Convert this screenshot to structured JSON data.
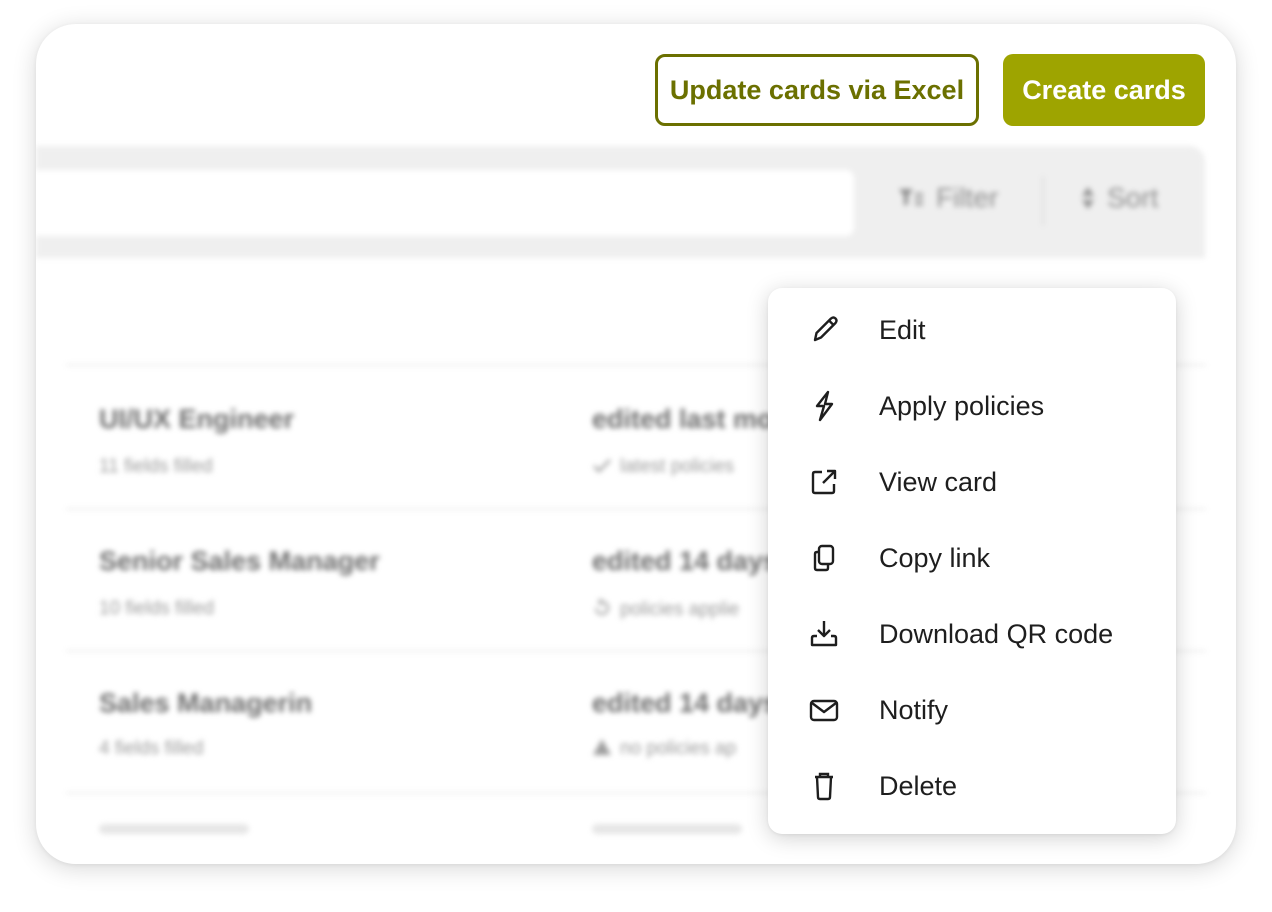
{
  "actions": {
    "update_excel_label": "Update cards via Excel",
    "create_cards_label": "Create cards",
    "accent_color": "#9ea400"
  },
  "toolbar": {
    "search_value": "",
    "filter_label": "Filter",
    "sort_label": "Sort"
  },
  "cards": [
    {
      "title": "UI/UX Engineer",
      "fields": "11 fields filled",
      "edited": "edited last mo",
      "policy": "latest policies",
      "policy_icon": "check-icon"
    },
    {
      "title": "Senior Sales Manager",
      "fields": "10 fields filled",
      "edited": "edited 14 days",
      "policy": "policies applie",
      "policy_icon": "history-icon"
    },
    {
      "title": "Sales Managerin",
      "fields": "4 fields filled",
      "edited": "edited 14 days",
      "policy": "no policies ap",
      "policy_icon": "warning-icon"
    }
  ],
  "context_menu": {
    "items": [
      {
        "label": "Edit",
        "icon": "pencil-icon"
      },
      {
        "label": "Apply policies",
        "icon": "lightning-icon"
      },
      {
        "label": "View card",
        "icon": "external-link-icon"
      },
      {
        "label": "Copy link",
        "icon": "copy-icon"
      },
      {
        "label": "Download QR code",
        "icon": "download-icon"
      },
      {
        "label": "Notify",
        "icon": "mail-icon"
      },
      {
        "label": "Delete",
        "icon": "trash-icon"
      }
    ]
  }
}
